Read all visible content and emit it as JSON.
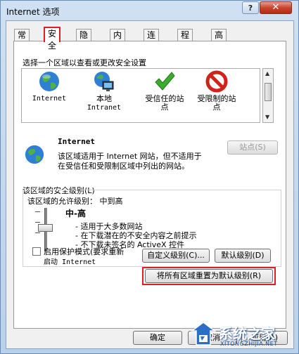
{
  "window": {
    "title": "Internet 选项"
  },
  "titlebar": {
    "help_label": "?",
    "close_label": "✕"
  },
  "tabs": [
    {
      "label": "常规"
    },
    {
      "label": "安全"
    },
    {
      "label": "隐私"
    },
    {
      "label": "内容"
    },
    {
      "label": "连接"
    },
    {
      "label": "程序"
    },
    {
      "label": "高级"
    }
  ],
  "security": {
    "select_zone_prompt": "选择一个区域以查看或更改安全设置",
    "zones": [
      {
        "label_line1": "Internet",
        "label_line2": "",
        "icon": "globe-icon"
      },
      {
        "label_line1": "本地",
        "label_line2": "Intranet",
        "icon": "intranet-icon"
      },
      {
        "label_line1": "受信任的站",
        "label_line2": "点",
        "icon": "checkmark-icon"
      },
      {
        "label_line1": "受限制的站",
        "label_line2": "点",
        "icon": "restricted-icon"
      }
    ],
    "selected_zone": {
      "name": "Internet",
      "desc_line1": "该区域适用于 Internet 网站，但不适用于",
      "desc_line2": "在受信任和受限制区域中列出的网站。"
    },
    "sites_button": "站点(S)",
    "level_group_label": "该区域的安全级别(L)",
    "allowed_levels_label": "该区域的允许级别： 中到高",
    "level_name": "中-高",
    "level_bullets": [
      "- 适用于大多数网站",
      "- 在下载潜在的不安全内容之前提示",
      "- 不下载未签名的 ActiveX 控件"
    ],
    "protected_mode_line1": "启用保护模式(要求重新",
    "protected_mode_line2": "启动 Internet",
    "custom_level_button": "自定义级别(C)...",
    "default_level_button": "默认级别(D)",
    "reset_all_button": "将所有区域重置为默认级别(R)"
  },
  "footer": {
    "ok_button": "确定",
    "cancel_button": "取消",
    "apply_button": "应用(A)"
  },
  "watermark": {
    "text": "系统之家",
    "subtext": "XITONGZHIJIA.NET"
  }
}
